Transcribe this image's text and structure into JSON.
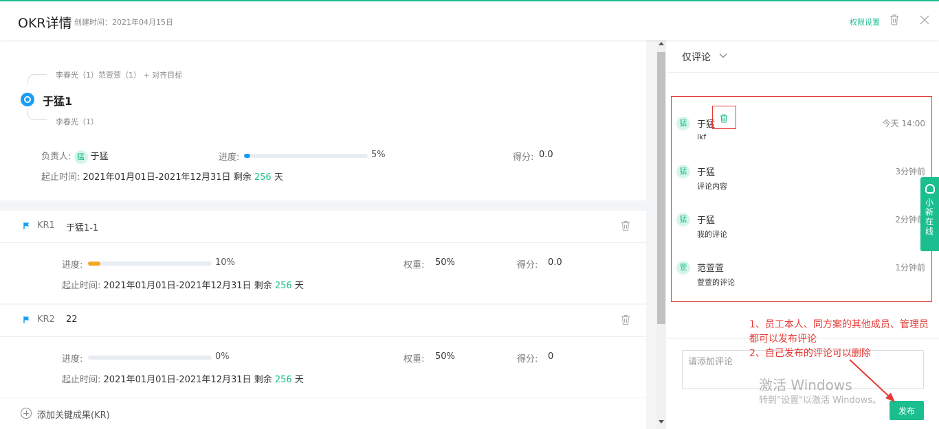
{
  "header": {
    "title": "OKR详情",
    "created": "创建时间：2021年04月15日",
    "permission_label": "权限设置"
  },
  "objective": {
    "parent_links": "李春光（1）范萱萱（1）",
    "align_label": "+ 对齐目标",
    "child_links": "李春光（1）",
    "title": "于猛1",
    "owner_label": "负责人:",
    "owner_avatar": "猛",
    "owner_name": "于猛",
    "progress_label": "进度:",
    "progress_text": "5%",
    "progress_value": 0.05,
    "score_label": "得分:",
    "score": "0.0",
    "period_label": "起止时间:",
    "period": "2021年01月01日-2021年12月31日 剩余",
    "remaining_days": "256",
    "days_unit": "天"
  },
  "key_results": [
    {
      "code": "KR1",
      "name": "于猛1-1",
      "progress_label": "进度:",
      "progress_text": "10%",
      "progress_value": 0.1,
      "progress_color": "#f5a623",
      "weight_label": "权重:",
      "weight": "50%",
      "score_label": "得分:",
      "score": "0.0",
      "period_label": "起止时间:",
      "period": "2021年01月01日-2021年12月31日 剩余",
      "remaining_days": "256",
      "days_unit": "天"
    },
    {
      "code": "KR2",
      "name": "22",
      "progress_label": "进度:",
      "progress_text": "0%",
      "progress_value": 0.0,
      "progress_color": "#f5a623",
      "weight_label": "权重:",
      "weight": "50%",
      "score_label": "得分:",
      "score": "0",
      "period_label": "起止时间:",
      "period": "2021年01月01日-2021年12月31日 剩余",
      "remaining_days": "256",
      "days_unit": "天"
    }
  ],
  "add_kr_label": "添加关键成果(KR)",
  "comments_panel": {
    "filter_label": "仅评论",
    "comments": [
      {
        "avatar": "猛",
        "name": "于猛",
        "time": "今天 14:00",
        "text": "lkf"
      },
      {
        "avatar": "猛",
        "name": "于猛",
        "time": "3分钟前",
        "text": "评论内容"
      },
      {
        "avatar": "猛",
        "name": "于猛",
        "time": "2分钟前",
        "text": "我的评论"
      },
      {
        "avatar": "萱",
        "name": "范萱萱",
        "time": "1分钟前",
        "text": "萱萱的评论"
      }
    ],
    "input_placeholder": "请添加评论",
    "publish_label": "发布"
  },
  "side_tab_label": "小新在线",
  "annotation": {
    "line1": "1、员工本人、同方案的其他成员、管理员都可以发布评论",
    "line2": "2、自己发布的评论可以删除"
  },
  "watermark": {
    "line1": "激活 Windows",
    "line2": "转到\"设置\"以激活 Windows。"
  },
  "colors": {
    "accent": "#1bbf8f",
    "objective_icon": "#1a9ef5",
    "annotation_red": "#e53935"
  }
}
